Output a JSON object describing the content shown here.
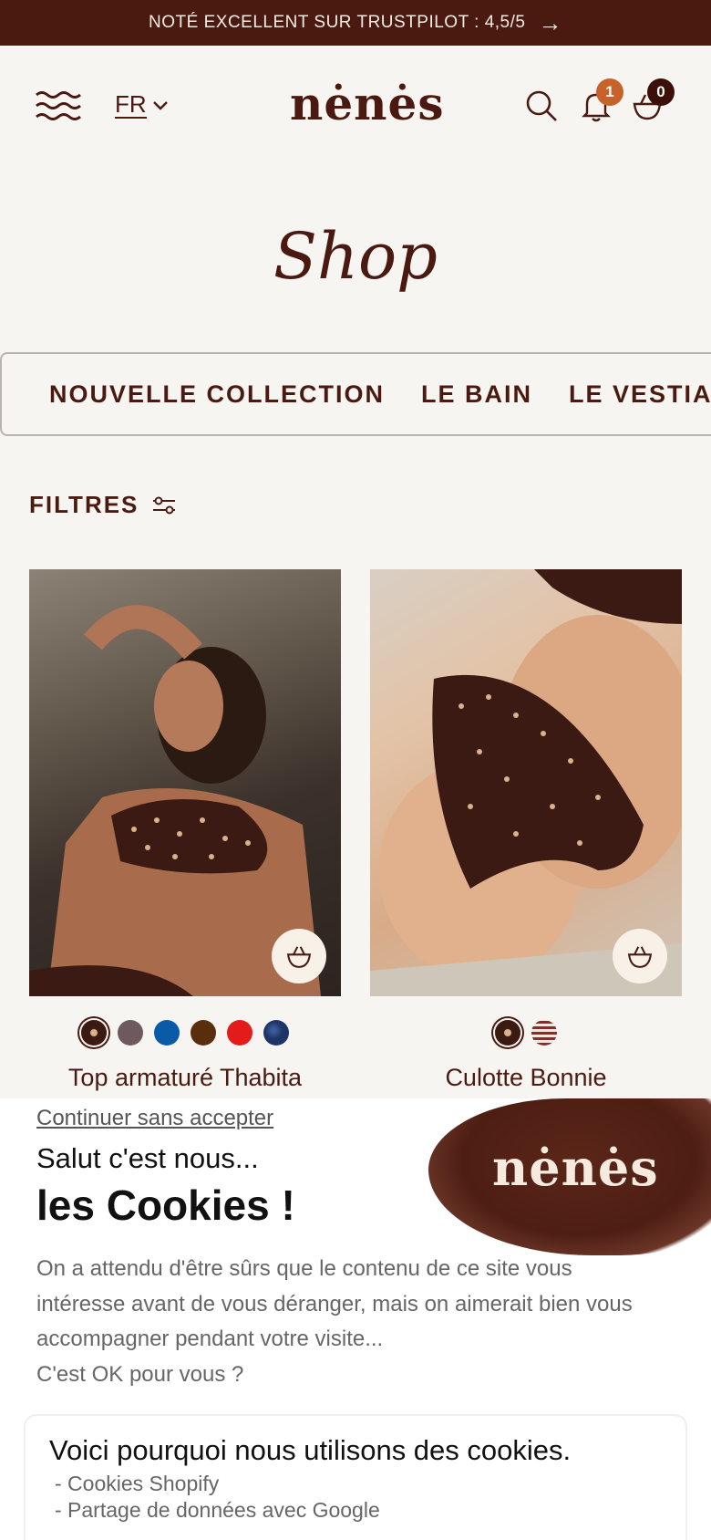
{
  "announcement": {
    "text": "NOTÉ EXCELLENT SUR TRUSTPILOT : 4,5/5",
    "arrow": "→"
  },
  "header": {
    "language": "FR",
    "logo": "nėnės",
    "notifications_count": "1",
    "cart_count": "0"
  },
  "page_title": "Shop",
  "categories": [
    "NOUVELLE COLLECTION",
    "LE BAIN",
    "LE VESTIAIRE"
  ],
  "filters_label": "FILTRES",
  "products": [
    {
      "name": "Top armaturé Thabita",
      "swatches": [
        "#3b1a12",
        "#6e5a5e",
        "#0b5aa8",
        "#5a2e0c",
        "#e41b1b",
        "#1d3566"
      ]
    },
    {
      "name": "Culotte Bonnie",
      "swatches": [
        "#3b1a12",
        "#8a2a2a"
      ]
    }
  ],
  "cookie_banner": {
    "skip_link": "Continuer sans accepter",
    "greeting": "Salut c'est nous...",
    "headline": "les Cookies !",
    "description": "On a attendu d'être sûrs que le contenu de ce site vous intéresse avant de vous déranger, mais on aimerait bien vous accompagner pendant votre visite...",
    "question": "C'est OK pour vous ?",
    "logo": "nėnės",
    "panel_title": "Voici pourquoi nous utilisons des cookies.",
    "reasons": [
      "- Cookies Shopify",
      "- Partage de données avec Google"
    ]
  },
  "colors": {
    "brand": "#4a1a10",
    "notif_badge": "#c8622b",
    "cart_badge": "#3b1009"
  }
}
